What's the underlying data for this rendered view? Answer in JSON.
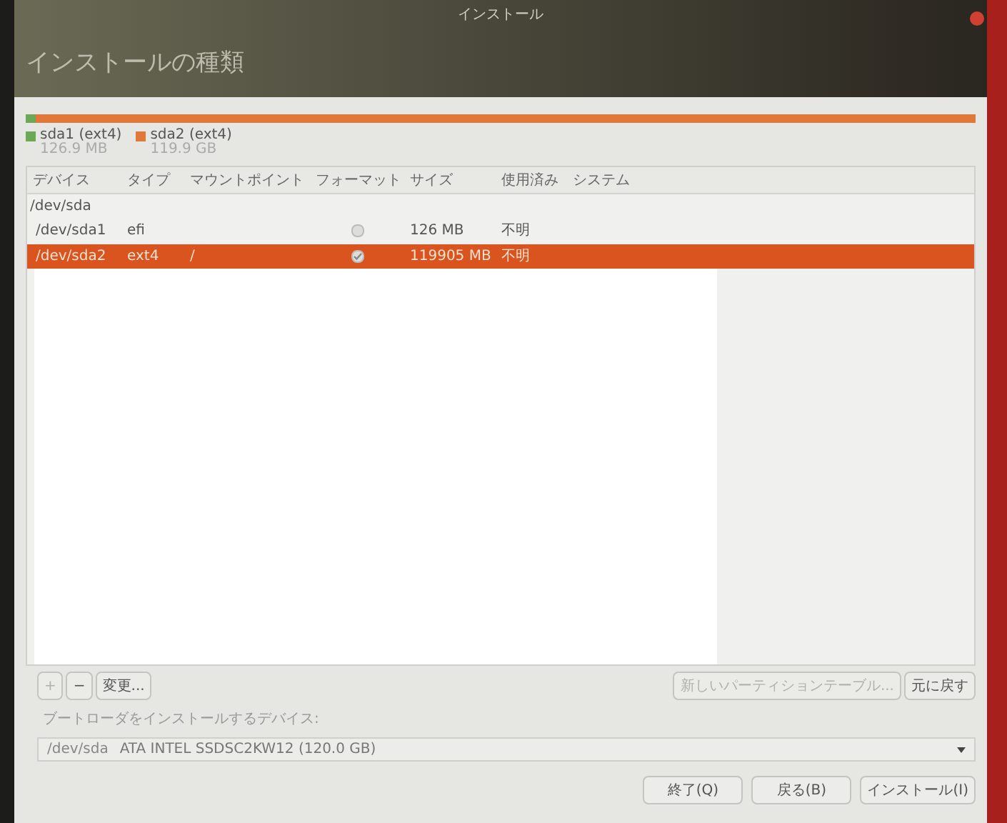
{
  "window": {
    "title": "インストール",
    "heading": "インストールの種類"
  },
  "partition_bar": {
    "segments": [
      {
        "name": "sda1 (ext4)",
        "size": "126.9 MB",
        "color": "#6ca855",
        "level": 0.01
      },
      {
        "name": "sda2 (ext4)",
        "size": "119.9 GB",
        "color": "#e0783a",
        "level": 0.99
      }
    ]
  },
  "table": {
    "columns": [
      "デバイス",
      "タイプ",
      "マウントポイント",
      "フォーマット",
      "サイズ",
      "使用済み",
      "システム"
    ],
    "rows": [
      {
        "device": "/dev/sda",
        "children": [
          {
            "device": "/dev/sda1",
            "type": "efi",
            "format": false,
            "size": "126 MB",
            "used": "不明",
            "selected": false
          },
          {
            "device": "/dev/sda2",
            "type": "ext4",
            "mount": "/",
            "format": true,
            "size": "119905 MB",
            "used": "不明",
            "selected": true
          }
        ]
      }
    ]
  },
  "redaction": true,
  "table_buttons": [
    {
      "label": "+",
      "disabled": true
    },
    {
      "label": "−",
      "disabled": false
    },
    {
      "label": "変更...",
      "disabled": false
    }
  ],
  "table_buttons_right": [
    {
      "label": "新しいパーティションテーブル...",
      "disabled": true
    },
    {
      "label": "元に戻す",
      "disabled": false
    }
  ],
  "bootloader": {
    "label": "ブートローダをインストールするデバイス:",
    "device": "/dev/sda",
    "description": "ATA INTEL SSDSC2KW12 (120.0 GB)"
  },
  "buttons": [
    "終了(Q)",
    "戻る(B)",
    "インストール(I)"
  ]
}
